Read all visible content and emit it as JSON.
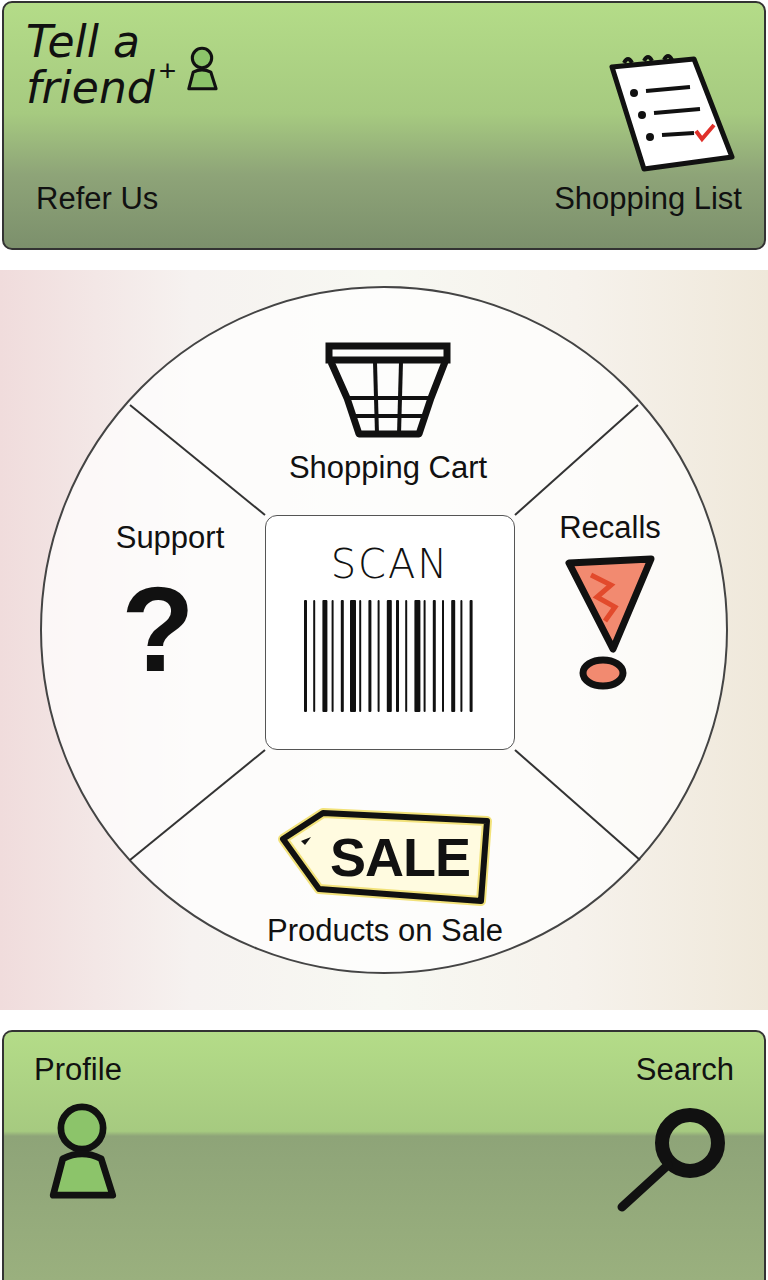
{
  "top_bar": {
    "refer": {
      "logo_line1": "Tell a",
      "logo_line2": "friend",
      "logo_plus": "+",
      "label": "Refer Us"
    },
    "shopping_list": {
      "label": "Shopping List"
    }
  },
  "wheel": {
    "scan": {
      "label": "SCAN"
    },
    "shopping_cart": {
      "label": "Shopping Cart"
    },
    "recalls": {
      "label": "Recalls"
    },
    "products_on_sale": {
      "label": "Products on Sale",
      "tag": "SALE"
    },
    "support": {
      "label": "Support",
      "icon": "?"
    }
  },
  "bottom_bar": {
    "profile": {
      "label": "Profile"
    },
    "search": {
      "label": "Search"
    }
  }
}
